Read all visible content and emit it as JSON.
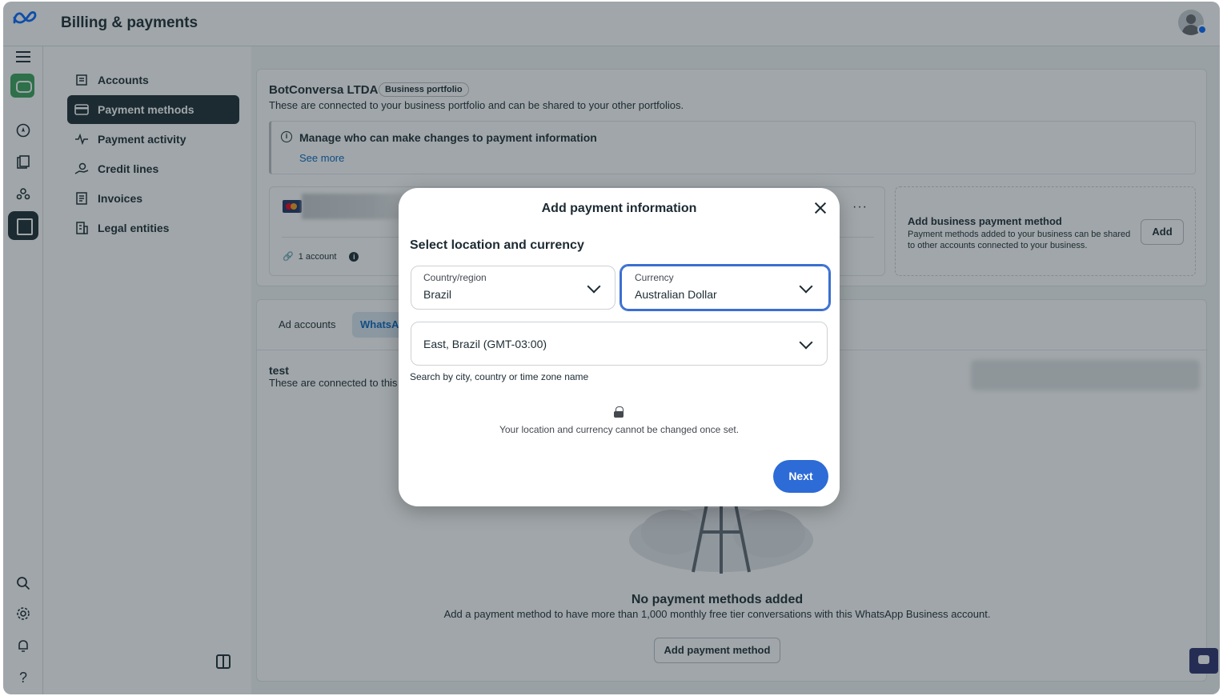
{
  "app": {
    "title": "Billing & payments"
  },
  "nav": {
    "items": [
      {
        "label": "Accounts",
        "icon": "accounts-icon"
      },
      {
        "label": "Payment methods",
        "icon": "card-icon",
        "active": true
      },
      {
        "label": "Payment activity",
        "icon": "activity-icon"
      },
      {
        "label": "Credit lines",
        "icon": "credit-icon"
      },
      {
        "label": "Invoices",
        "icon": "invoice-icon"
      },
      {
        "label": "Legal entities",
        "icon": "building-icon"
      }
    ]
  },
  "portfolio": {
    "name": "BotConversa LTDA",
    "badge": "Business portfolio",
    "description": "These are connected to your business portfolio and can be shared to your other portfolios.",
    "notice_title": "Manage who can make changes to payment information",
    "notice_link": "See more",
    "accounts_count": "1 account",
    "add_title": "Add business payment method",
    "add_description": "Payment methods added to your business can be shared to other accounts connected to your business.",
    "add_button": "Add"
  },
  "whatsapp": {
    "tabs": [
      "Ad accounts",
      "WhatsA"
    ],
    "account_name": "test",
    "account_desc": "These are connected to this",
    "empty_title": "No payment methods added",
    "empty_desc": "Add a payment method to have more than 1,000 monthly free tier conversations with this WhatsApp Business account.",
    "empty_button": "Add payment method"
  },
  "modal": {
    "title": "Add payment information",
    "section_title": "Select location and currency",
    "country_label": "Country/region",
    "country_value": "Brazil",
    "currency_label": "Currency",
    "currency_value": "Australian Dollar",
    "timezone_value": "East, Brazil (GMT-03:00)",
    "timezone_helper": "Search by city, country or time zone name",
    "lock_text": "Your location and currency cannot be changed once set.",
    "next_button": "Next"
  },
  "colors": {
    "accent": "#2d6bd6",
    "nav_active": "#1c2b33"
  }
}
